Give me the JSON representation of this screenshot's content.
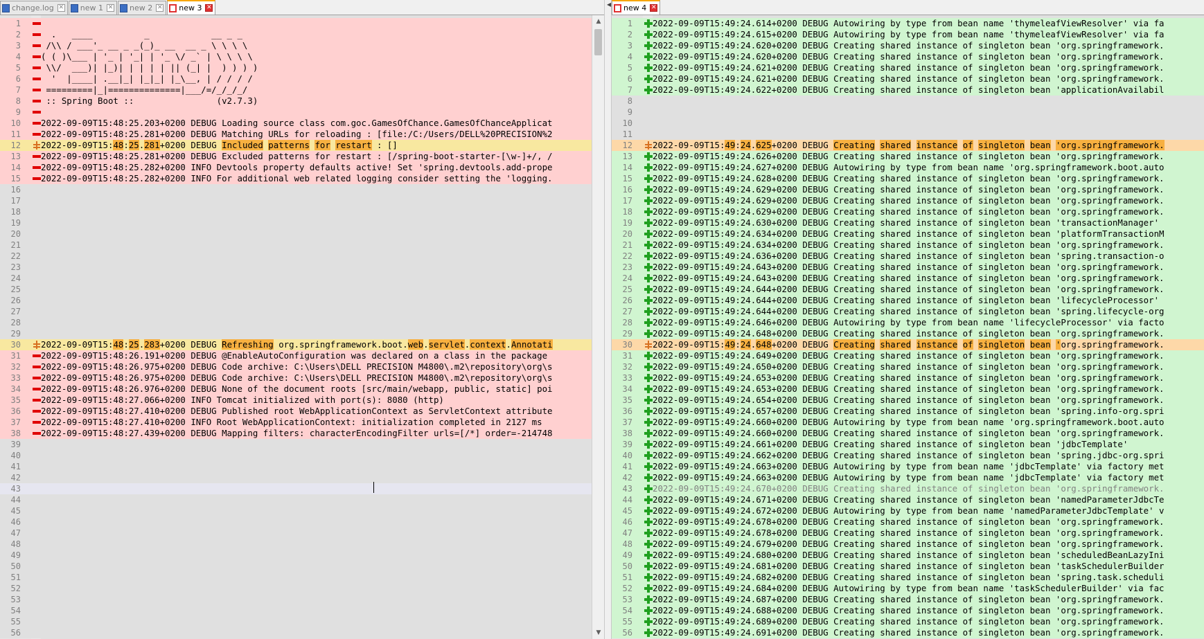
{
  "left_tabs": [
    {
      "label": "change.log",
      "state": "saved",
      "active": false
    },
    {
      "label": "new 1",
      "state": "saved",
      "active": false
    },
    {
      "label": "new 2",
      "state": "saved",
      "active": false
    },
    {
      "label": "new 3",
      "state": "unsaved",
      "active": true
    }
  ],
  "right_tabs": [
    {
      "label": "new 4",
      "state": "unsaved",
      "active": true
    }
  ],
  "close_glyph": "✕",
  "colors": {
    "deleted": "#ffd0d0",
    "added": "#d0f5d0",
    "changed": "#f8e8a0",
    "word_diff": "#f7b040",
    "blank": "#e0e0e0"
  },
  "left_lines": [
    {
      "n": "1",
      "t": "del",
      "text": ""
    },
    {
      "n": "2",
      "t": "del",
      "text": "  .   ____          _            __ _ _"
    },
    {
      "n": "3",
      "t": "del",
      "text": " /\\\\ / ___'_ __ _ _(_)_ __  __ _ \\ \\ \\ \\"
    },
    {
      "n": "4",
      "t": "del",
      "text": "( ( )\\___ | '_ | '_| | '_ \\/ _` | \\ \\ \\ \\"
    },
    {
      "n": "5",
      "t": "del",
      "text": " \\\\/  ___)| |_)| | | | | || (_| |  ) ) ) )"
    },
    {
      "n": "6",
      "t": "del",
      "text": "  '  |____| .__|_| |_|_| |_\\__, | / / / /"
    },
    {
      "n": "7",
      "t": "del",
      "text": " =========|_|==============|___/=/_/_/_/"
    },
    {
      "n": "8",
      "t": "del",
      "text": " :: Spring Boot ::                (v2.7.3)"
    },
    {
      "n": "9",
      "t": "del",
      "text": ""
    },
    {
      "n": "10",
      "t": "del",
      "text": "2022-09-09T15:48:25.203+0200 DEBUG Loading source class com.goc.GamesOfChance.GamesOfChanceApplicat"
    },
    {
      "n": "11",
      "t": "del",
      "text": "2022-09-09T15:48:25.281+0200 DEBUG Matching URLs for reloading : [file:/C:/Users/DELL%20PRECISION%2"
    },
    {
      "n": "12",
      "t": "chg",
      "segs": [
        {
          "s": "2022-09-09T15:",
          "h": false
        },
        {
          "s": "48",
          "h": true
        },
        {
          "s": ":",
          "h": false
        },
        {
          "s": "25",
          "h": true
        },
        {
          "s": ".",
          "h": false
        },
        {
          "s": "281",
          "h": true
        },
        {
          "s": "+0200 DEBUG ",
          "h": false
        },
        {
          "s": "Included",
          "h": true
        },
        {
          "s": " ",
          "h": false
        },
        {
          "s": "patterns",
          "h": true
        },
        {
          "s": " ",
          "h": false
        },
        {
          "s": "for",
          "h": true
        },
        {
          "s": " ",
          "h": false
        },
        {
          "s": "restart",
          "h": true
        },
        {
          "s": " : []",
          "h": false
        }
      ]
    },
    {
      "n": "13",
      "t": "del",
      "text": "2022-09-09T15:48:25.281+0200 DEBUG Excluded patterns for restart : [/spring-boot-starter-[\\w-]+/, /"
    },
    {
      "n": "14",
      "t": "del",
      "text": "2022-09-09T15:48:25.282+0200 INFO Devtools property defaults active! Set 'spring.devtools.add-prope"
    },
    {
      "n": "15",
      "t": "del",
      "text": "2022-09-09T15:48:25.282+0200 INFO For additional web related logging consider setting the 'logging."
    },
    {
      "n": "16",
      "t": "blank",
      "text": ""
    },
    {
      "n": "17",
      "t": "blank",
      "text": ""
    },
    {
      "n": "18",
      "t": "blank",
      "text": ""
    },
    {
      "n": "19",
      "t": "blank",
      "text": ""
    },
    {
      "n": "20",
      "t": "blank",
      "text": ""
    },
    {
      "n": "21",
      "t": "blank",
      "text": ""
    },
    {
      "n": "22",
      "t": "blank",
      "text": ""
    },
    {
      "n": "23",
      "t": "blank",
      "text": ""
    },
    {
      "n": "24",
      "t": "blank",
      "text": ""
    },
    {
      "n": "25",
      "t": "blank",
      "text": ""
    },
    {
      "n": "26",
      "t": "blank",
      "text": ""
    },
    {
      "n": "27",
      "t": "blank",
      "text": ""
    },
    {
      "n": "28",
      "t": "blank",
      "text": ""
    },
    {
      "n": "29",
      "t": "blank",
      "text": ""
    },
    {
      "n": "30",
      "t": "chg",
      "segs": [
        {
          "s": "2022-09-09T15:",
          "h": false
        },
        {
          "s": "48",
          "h": true
        },
        {
          "s": ":",
          "h": false
        },
        {
          "s": "25",
          "h": true
        },
        {
          "s": ".",
          "h": false
        },
        {
          "s": "283",
          "h": true
        },
        {
          "s": "+0200 DEBUG ",
          "h": false
        },
        {
          "s": "Refreshing",
          "h": true
        },
        {
          "s": " org.springframework.boot.",
          "h": false
        },
        {
          "s": "web",
          "h": true
        },
        {
          "s": ".",
          "h": false
        },
        {
          "s": "servlet",
          "h": true
        },
        {
          "s": ".",
          "h": false
        },
        {
          "s": "context",
          "h": true
        },
        {
          "s": ".",
          "h": false
        },
        {
          "s": "Annotati",
          "h": true
        }
      ]
    },
    {
      "n": "31",
      "t": "del",
      "text": "2022-09-09T15:48:26.191+0200 DEBUG @EnableAutoConfiguration was declared on a class in the package"
    },
    {
      "n": "32",
      "t": "del",
      "text": "2022-09-09T15:48:26.975+0200 DEBUG Code archive: C:\\Users\\DELL PRECISION M4800\\.m2\\repository\\org\\s"
    },
    {
      "n": "33",
      "t": "del",
      "text": "2022-09-09T15:48:26.975+0200 DEBUG Code archive: C:\\Users\\DELL PRECISION M4800\\.m2\\repository\\org\\s"
    },
    {
      "n": "34",
      "t": "del",
      "text": "2022-09-09T15:48:26.976+0200 DEBUG None of the document roots [src/main/webapp, public, static] poi"
    },
    {
      "n": "35",
      "t": "del",
      "text": "2022-09-09T15:48:27.066+0200 INFO Tomcat initialized with port(s): 8080 (http)"
    },
    {
      "n": "36",
      "t": "del",
      "text": "2022-09-09T15:48:27.410+0200 DEBUG Published root WebApplicationContext as ServletContext attribute"
    },
    {
      "n": "37",
      "t": "del",
      "text": "2022-09-09T15:48:27.410+0200 INFO Root WebApplicationContext: initialization completed in 2127 ms"
    },
    {
      "n": "38",
      "t": "del",
      "text": "2022-09-09T15:48:27.439+0200 DEBUG Mapping filters: characterEncodingFilter urls=[/*] order=-214748"
    },
    {
      "n": "39",
      "t": "blank",
      "text": ""
    },
    {
      "n": "40",
      "t": "blank",
      "text": ""
    },
    {
      "n": "41",
      "t": "blank",
      "text": ""
    },
    {
      "n": "42",
      "t": "blank",
      "text": ""
    },
    {
      "n": "43",
      "t": "cur",
      "text": ""
    },
    {
      "n": "44",
      "t": "blank",
      "text": ""
    },
    {
      "n": "45",
      "t": "blank",
      "text": ""
    },
    {
      "n": "46",
      "t": "blank",
      "text": ""
    },
    {
      "n": "47",
      "t": "blank",
      "text": ""
    },
    {
      "n": "48",
      "t": "blank",
      "text": ""
    },
    {
      "n": "49",
      "t": "blank",
      "text": ""
    },
    {
      "n": "50",
      "t": "blank",
      "text": ""
    },
    {
      "n": "51",
      "t": "blank",
      "text": ""
    },
    {
      "n": "52",
      "t": "blank",
      "text": ""
    },
    {
      "n": "53",
      "t": "blank",
      "text": ""
    },
    {
      "n": "54",
      "t": "blank",
      "text": ""
    },
    {
      "n": "55",
      "t": "blank",
      "text": ""
    },
    {
      "n": "56",
      "t": "blank",
      "text": ""
    }
  ],
  "right_lines": [
    {
      "n": "1",
      "t": "add",
      "text": "2022-09-09T15:49:24.614+0200 DEBUG Autowiring by type from bean name 'thymeleafViewResolver' via fa"
    },
    {
      "n": "2",
      "t": "add",
      "text": "2022-09-09T15:49:24.615+0200 DEBUG Autowiring by type from bean name 'thymeleafViewResolver' via fa"
    },
    {
      "n": "3",
      "t": "add",
      "text": "2022-09-09T15:49:24.620+0200 DEBUG Creating shared instance of singleton bean 'org.springframework."
    },
    {
      "n": "4",
      "t": "add",
      "text": "2022-09-09T15:49:24.620+0200 DEBUG Creating shared instance of singleton bean 'org.springframework."
    },
    {
      "n": "5",
      "t": "add",
      "text": "2022-09-09T15:49:24.621+0200 DEBUG Creating shared instance of singleton bean 'org.springframework."
    },
    {
      "n": "6",
      "t": "add",
      "text": "2022-09-09T15:49:24.621+0200 DEBUG Creating shared instance of singleton bean 'org.springframework."
    },
    {
      "n": "7",
      "t": "add",
      "text": "2022-09-09T15:49:24.622+0200 DEBUG Creating shared instance of singleton bean 'applicationAvailabil"
    },
    {
      "n": "8",
      "t": "blank",
      "text": ""
    },
    {
      "n": "9",
      "t": "blank",
      "text": ""
    },
    {
      "n": "10",
      "t": "blank",
      "text": ""
    },
    {
      "n": "11",
      "t": "blank",
      "text": ""
    },
    {
      "n": "12",
      "t": "chgo",
      "segs": [
        {
          "s": "2022-09-09T15:",
          "h": false
        },
        {
          "s": "49",
          "h": true
        },
        {
          "s": ":",
          "h": false
        },
        {
          "s": "24",
          "h": true
        },
        {
          "s": ".",
          "h": false
        },
        {
          "s": "625",
          "h": true
        },
        {
          "s": "+0200 DEBUG ",
          "h": false
        },
        {
          "s": "Creating",
          "h": true
        },
        {
          "s": " ",
          "h": false
        },
        {
          "s": "shared",
          "h": true
        },
        {
          "s": " ",
          "h": false
        },
        {
          "s": "instance",
          "h": true
        },
        {
          "s": " ",
          "h": false
        },
        {
          "s": "of",
          "h": true
        },
        {
          "s": " ",
          "h": false
        },
        {
          "s": "singleton",
          "h": true
        },
        {
          "s": " ",
          "h": false
        },
        {
          "s": "bean",
          "h": true
        },
        {
          "s": " ",
          "h": false
        },
        {
          "s": "'org.springframework.",
          "h": true
        }
      ]
    },
    {
      "n": "13",
      "t": "add",
      "text": "2022-09-09T15:49:24.626+0200 DEBUG Creating shared instance of singleton bean 'org.springframework."
    },
    {
      "n": "14",
      "t": "add",
      "text": "2022-09-09T15:49:24.627+0200 DEBUG Autowiring by type from bean name 'org.springframework.boot.auto"
    },
    {
      "n": "15",
      "t": "add",
      "text": "2022-09-09T15:49:24.628+0200 DEBUG Creating shared instance of singleton bean 'org.springframework."
    },
    {
      "n": "16",
      "t": "add",
      "text": "2022-09-09T15:49:24.629+0200 DEBUG Creating shared instance of singleton bean 'org.springframework."
    },
    {
      "n": "17",
      "t": "add",
      "text": "2022-09-09T15:49:24.629+0200 DEBUG Creating shared instance of singleton bean 'org.springframework."
    },
    {
      "n": "18",
      "t": "add",
      "text": "2022-09-09T15:49:24.629+0200 DEBUG Creating shared instance of singleton bean 'org.springframework."
    },
    {
      "n": "19",
      "t": "add",
      "text": "2022-09-09T15:49:24.630+0200 DEBUG Creating shared instance of singleton bean 'transactionManager'"
    },
    {
      "n": "20",
      "t": "add",
      "text": "2022-09-09T15:49:24.634+0200 DEBUG Creating shared instance of singleton bean 'platformTransactionM"
    },
    {
      "n": "21",
      "t": "add",
      "text": "2022-09-09T15:49:24.634+0200 DEBUG Creating shared instance of singleton bean 'org.springframework."
    },
    {
      "n": "22",
      "t": "add",
      "text": "2022-09-09T15:49:24.636+0200 DEBUG Creating shared instance of singleton bean 'spring.transaction-o"
    },
    {
      "n": "23",
      "t": "add",
      "text": "2022-09-09T15:49:24.643+0200 DEBUG Creating shared instance of singleton bean 'org.springframework."
    },
    {
      "n": "24",
      "t": "add",
      "text": "2022-09-09T15:49:24.643+0200 DEBUG Creating shared instance of singleton bean 'org.springframework."
    },
    {
      "n": "25",
      "t": "add",
      "text": "2022-09-09T15:49:24.644+0200 DEBUG Creating shared instance of singleton bean 'org.springframework."
    },
    {
      "n": "26",
      "t": "add",
      "text": "2022-09-09T15:49:24.644+0200 DEBUG Creating shared instance of singleton bean 'lifecycleProcessor'"
    },
    {
      "n": "27",
      "t": "add",
      "text": "2022-09-09T15:49:24.644+0200 DEBUG Creating shared instance of singleton bean 'spring.lifecycle-org"
    },
    {
      "n": "28",
      "t": "add",
      "text": "2022-09-09T15:49:24.646+0200 DEBUG Autowiring by type from bean name 'lifecycleProcessor' via facto"
    },
    {
      "n": "29",
      "t": "add",
      "text": "2022-09-09T15:49:24.648+0200 DEBUG Creating shared instance of singleton bean 'org.springframework."
    },
    {
      "n": "30",
      "t": "chgo",
      "segs": [
        {
          "s": "2022-09-09T15:",
          "h": false
        },
        {
          "s": "49",
          "h": true
        },
        {
          "s": ":",
          "h": false
        },
        {
          "s": "24",
          "h": true
        },
        {
          "s": ".",
          "h": false
        },
        {
          "s": "648",
          "h": true
        },
        {
          "s": "+0200 DEBUG ",
          "h": false
        },
        {
          "s": "Creating",
          "h": true
        },
        {
          "s": " ",
          "h": false
        },
        {
          "s": "shared",
          "h": true
        },
        {
          "s": " ",
          "h": false
        },
        {
          "s": "instance",
          "h": true
        },
        {
          "s": " ",
          "h": false
        },
        {
          "s": "of",
          "h": true
        },
        {
          "s": " ",
          "h": false
        },
        {
          "s": "singleton",
          "h": true
        },
        {
          "s": " ",
          "h": false
        },
        {
          "s": "bean",
          "h": true
        },
        {
          "s": " ",
          "h": false
        },
        {
          "s": "'",
          "h": true
        },
        {
          "s": "org.springframework.",
          "h": false
        }
      ]
    },
    {
      "n": "31",
      "t": "add",
      "text": "2022-09-09T15:49:24.649+0200 DEBUG Creating shared instance of singleton bean 'org.springframework."
    },
    {
      "n": "32",
      "t": "add",
      "text": "2022-09-09T15:49:24.650+0200 DEBUG Creating shared instance of singleton bean 'org.springframework."
    },
    {
      "n": "33",
      "t": "add",
      "text": "2022-09-09T15:49:24.653+0200 DEBUG Creating shared instance of singleton bean 'org.springframework."
    },
    {
      "n": "34",
      "t": "add",
      "text": "2022-09-09T15:49:24.653+0200 DEBUG Creating shared instance of singleton bean 'org.springframework."
    },
    {
      "n": "35",
      "t": "add",
      "text": "2022-09-09T15:49:24.654+0200 DEBUG Creating shared instance of singleton bean 'org.springframework."
    },
    {
      "n": "36",
      "t": "add",
      "text": "2022-09-09T15:49:24.657+0200 DEBUG Creating shared instance of singleton bean 'spring.info-org.spri"
    },
    {
      "n": "37",
      "t": "add",
      "text": "2022-09-09T15:49:24.660+0200 DEBUG Autowiring by type from bean name 'org.springframework.boot.auto"
    },
    {
      "n": "38",
      "t": "add",
      "text": "2022-09-09T15:49:24.660+0200 DEBUG Creating shared instance of singleton bean 'org.springframework."
    },
    {
      "n": "39",
      "t": "add",
      "text": "2022-09-09T15:49:24.661+0200 DEBUG Creating shared instance of singleton bean 'jdbcTemplate'"
    },
    {
      "n": "40",
      "t": "add",
      "text": "2022-09-09T15:49:24.662+0200 DEBUG Creating shared instance of singleton bean 'spring.jdbc-org.spri"
    },
    {
      "n": "41",
      "t": "add",
      "text": "2022-09-09T15:49:24.663+0200 DEBUG Autowiring by type from bean name 'jdbcTemplate' via factory met"
    },
    {
      "n": "42",
      "t": "add",
      "text": "2022-09-09T15:49:24.663+0200 DEBUG Autowiring by type from bean name 'jdbcTemplate' via factory met"
    },
    {
      "n": "43",
      "t": "addcur",
      "text": "2022-09-09T15:49:24.670+0200 DEBUG Creating shared instance of singleton bean 'org.springframework."
    },
    {
      "n": "44",
      "t": "add",
      "text": "2022-09-09T15:49:24.671+0200 DEBUG Creating shared instance of singleton bean 'namedParameterJdbcTe"
    },
    {
      "n": "45",
      "t": "add",
      "text": "2022-09-09T15:49:24.672+0200 DEBUG Autowiring by type from bean name 'namedParameterJdbcTemplate' v"
    },
    {
      "n": "46",
      "t": "add",
      "text": "2022-09-09T15:49:24.678+0200 DEBUG Creating shared instance of singleton bean 'org.springframework."
    },
    {
      "n": "47",
      "t": "add",
      "text": "2022-09-09T15:49:24.678+0200 DEBUG Creating shared instance of singleton bean 'org.springframework."
    },
    {
      "n": "48",
      "t": "add",
      "text": "2022-09-09T15:49:24.679+0200 DEBUG Creating shared instance of singleton bean 'org.springframework."
    },
    {
      "n": "49",
      "t": "add",
      "text": "2022-09-09T15:49:24.680+0200 DEBUG Creating shared instance of singleton bean 'scheduledBeanLazyIni"
    },
    {
      "n": "50",
      "t": "add",
      "text": "2022-09-09T15:49:24.681+0200 DEBUG Creating shared instance of singleton bean 'taskSchedulerBuilder"
    },
    {
      "n": "51",
      "t": "add",
      "text": "2022-09-09T15:49:24.682+0200 DEBUG Creating shared instance of singleton bean 'spring.task.scheduli"
    },
    {
      "n": "52",
      "t": "add",
      "text": "2022-09-09T15:49:24.684+0200 DEBUG Autowiring by type from bean name 'taskSchedulerBuilder' via fac"
    },
    {
      "n": "53",
      "t": "add",
      "text": "2022-09-09T15:49:24.687+0200 DEBUG Creating shared instance of singleton bean 'org.springframework."
    },
    {
      "n": "54",
      "t": "add",
      "text": "2022-09-09T15:49:24.688+0200 DEBUG Creating shared instance of singleton bean 'org.springframework."
    },
    {
      "n": "55",
      "t": "add",
      "text": "2022-09-09T15:49:24.689+0200 DEBUG Creating shared instance of singleton bean 'org.springframework."
    },
    {
      "n": "56",
      "t": "add",
      "text": "2022-09-09T15:49:24.691+0200 DEBUG Creating shared instance of singleton bean 'org.springframework."
    }
  ]
}
